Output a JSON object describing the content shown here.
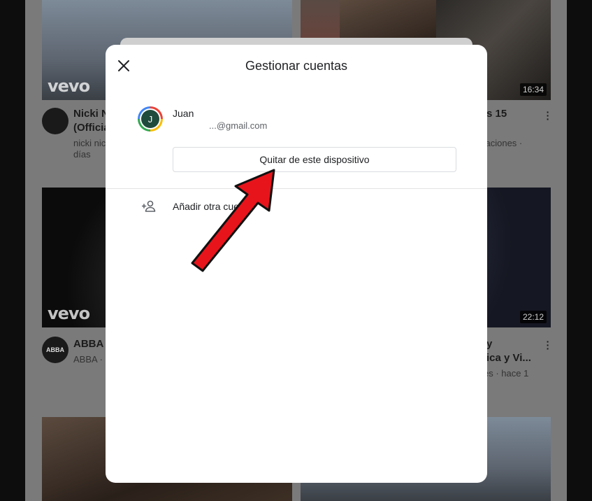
{
  "dialog": {
    "title": "Gestionar cuentas",
    "account": {
      "initial": "J",
      "name": "Juan",
      "email": "...@gmail.com"
    },
    "remove_button": "Quitar de este dispositivo",
    "add_account": "Añadir otra cuenta"
  },
  "feed": {
    "row1": {
      "left_duration": "",
      "right_duration": "16:34",
      "left_title_line1": "Nicki N",
      "left_title_line2": "(Officia",
      "left_meta_line1": "nicki nic",
      "left_meta_line2": "días",
      "right_title": "s 15",
      "right_meta": "caciones ·"
    },
    "row2": {
      "right_duration": "22:12",
      "left_channel_avatar": "ABBA",
      "left_title": "ABBA",
      "left_meta": "ABBA ·",
      "right_title_line1": "y",
      "right_title_line2": "ica y Vi...",
      "right_meta": "es · hace 1"
    },
    "vevo_label": "vevo"
  },
  "colors": {
    "overlay": "#7a7a7a",
    "dialog_bg": "#ffffff",
    "arrow": "#e8141b"
  }
}
